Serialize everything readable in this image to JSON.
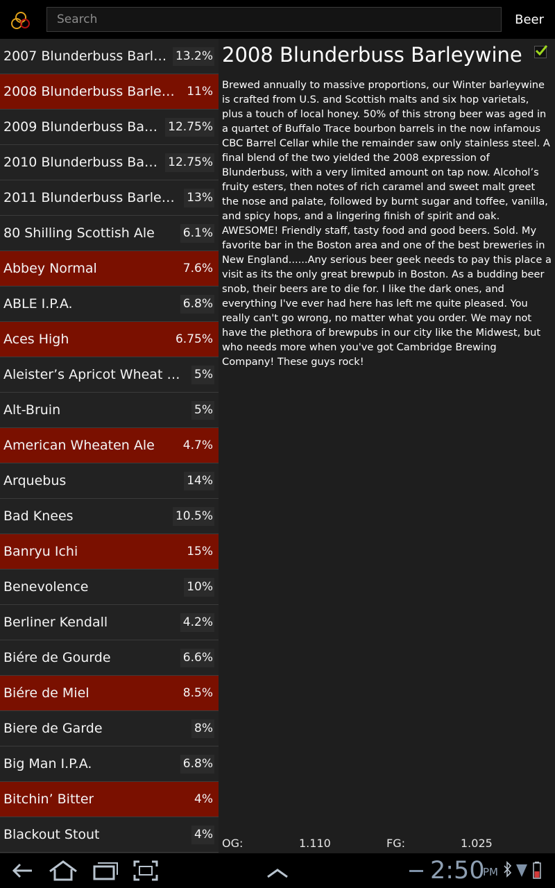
{
  "app": {
    "search_placeholder": "Search",
    "type_label": "Beer"
  },
  "beers": [
    {
      "name": "2007 Blunderbuss Barley...",
      "abv": "13.2%",
      "highlighted": false
    },
    {
      "name": "2008 Blunderbuss Barleywi...",
      "abv": "11%",
      "highlighted": true
    },
    {
      "name": "2009 Blunderbuss Barle...",
      "abv": "12.75%",
      "highlighted": false
    },
    {
      "name": "2010 Blunderbuss Barle...",
      "abv": "12.75%",
      "highlighted": false
    },
    {
      "name": "2011 Blunderbuss Barleywi...",
      "abv": "13%",
      "highlighted": false
    },
    {
      "name": "80 Shilling Scottish Ale",
      "abv": "6.1%",
      "highlighted": false
    },
    {
      "name": "Abbey Normal",
      "abv": "7.6%",
      "highlighted": true
    },
    {
      "name": "ABLE I.P.A.",
      "abv": "6.8%",
      "highlighted": false
    },
    {
      "name": "Aces High",
      "abv": "6.75%",
      "highlighted": true
    },
    {
      "name": "Aleister’s Apricot Wheat Ale",
      "abv": "5%",
      "highlighted": false
    },
    {
      "name": "Alt-Bruin",
      "abv": "5%",
      "highlighted": false
    },
    {
      "name": "American Wheaten Ale",
      "abv": "4.7%",
      "highlighted": true
    },
    {
      "name": "Arquebus",
      "abv": "14%",
      "highlighted": false
    },
    {
      "name": "Bad Knees",
      "abv": "10.5%",
      "highlighted": false
    },
    {
      "name": "Banryu Ichi",
      "abv": "15%",
      "highlighted": true
    },
    {
      "name": "Benevolence",
      "abv": "10%",
      "highlighted": false
    },
    {
      "name": "Berliner Kendall",
      "abv": "4.2%",
      "highlighted": false
    },
    {
      "name": "Biére de Gourde",
      "abv": "6.6%",
      "highlighted": false
    },
    {
      "name": "Biére de Miel",
      "abv": "8.5%",
      "highlighted": true
    },
    {
      "name": "Biere de Garde",
      "abv": "8%",
      "highlighted": false
    },
    {
      "name": "Big Man I.P.A.",
      "abv": "6.8%",
      "highlighted": false
    },
    {
      "name": "Bitchin’ Bitter",
      "abv": "4%",
      "highlighted": true
    },
    {
      "name": "Blackout Stout",
      "abv": "4%",
      "highlighted": false
    }
  ],
  "detail": {
    "title": "2008 Blunderbuss Barleywine",
    "checked": true,
    "description": "Brewed annually to massive proportions, our Winter barleywine is crafted from U.S. and Scottish malts and six hop varietals, plus a touch of local honey. 50% of this strong beer was aged in a quartet of Buffalo Trace bourbon barrels in the now infamous CBC Barrel Cellar while the remainder saw only stainless steel. A final blend of the two yielded the 2008 expression of Blunderbuss, with a very limited amount on tap now. Alcohol’s fruity esters, then notes of rich caramel and sweet malt greet the nose and palate, followed by burnt sugar and toffee, vanilla, and spicy hops, and a lingering finish of spirit and oak. AWESOME! Friendly staff, tasty food and good beers. Sold. My favorite bar in the Boston area and one of the best breweries in New England......Any serious beer geek needs to pay this place a visit as its the only great brewpub in Boston. As a budding beer snob, their beers are to die for. I like the dark ones, and everything I've ever had here has left me quite pleased. You really can't go wrong, no matter what you order. We may not have the plethora of brewpubs in our city like the Midwest, but who needs more when you've got Cambridge Brewing Company! These guys rock!",
    "og_label": "OG:",
    "og_value": "1.110",
    "fg_label": "FG:",
    "fg_value": "1.025"
  },
  "system_bar": {
    "time": "2:50",
    "ampm": "PM",
    "icons": [
      "back-icon",
      "home-icon",
      "recent-apps-icon",
      "screenshot-icon",
      "chevron-up-icon",
      "bluetooth-icon",
      "signal-icon",
      "battery-icon"
    ]
  }
}
